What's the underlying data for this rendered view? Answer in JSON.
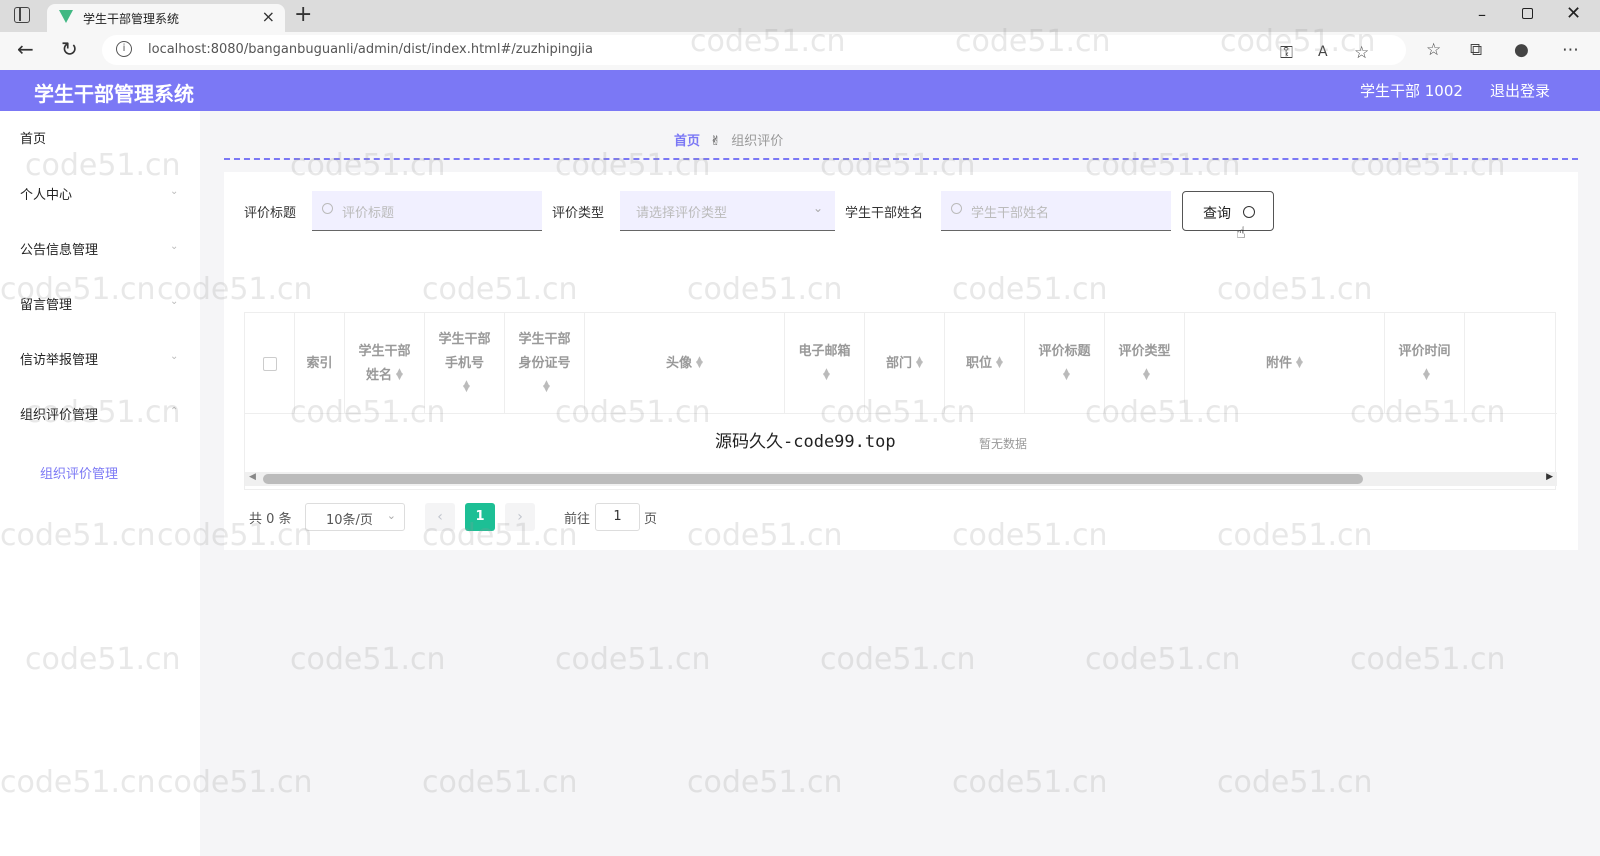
{
  "browser": {
    "tab_title": "学生干部管理系统",
    "tab_close": "×",
    "new_tab": "+",
    "url": "localhost:8080/banganbuguanli/admin/dist/index.html#/zuzhipingjia",
    "window_min": "–",
    "window_close": "✕"
  },
  "header": {
    "app_title": "学生干部管理系统",
    "user": "学生干部 1002",
    "logout": "退出登录"
  },
  "sidebar": {
    "items": [
      {
        "label": "首页"
      },
      {
        "label": "个人中心"
      },
      {
        "label": "公告信息管理"
      },
      {
        "label": "留言管理"
      },
      {
        "label": "信访举报管理"
      },
      {
        "label": "组织评价管理"
      }
    ],
    "submenu_label": "组织评价管理"
  },
  "breadcrumb": {
    "home": "首页",
    "current": "组织评价"
  },
  "filters": {
    "title_label": "评价标题",
    "title_placeholder": "评价标题",
    "type_label": "评价类型",
    "type_placeholder": "请选择评价类型",
    "name_label": "学生干部姓名",
    "name_placeholder": "学生干部姓名",
    "search_button": "查询"
  },
  "table": {
    "columns": {
      "index": "索引",
      "name_1": "学生干部",
      "name_2": "姓名",
      "phone_1": "学生干部",
      "phone_2": "手机号",
      "idcard_1": "学生干部",
      "idcard_2": "身份证号",
      "avatar": "头像",
      "email": "电子邮箱",
      "department": "部门",
      "position": "职位",
      "eval_title": "评价标题",
      "eval_type": "评价类型",
      "attachment": "附件",
      "eval_time": "评价时间"
    },
    "empty_text": "暂无数据",
    "center_watermark": "源码久久-code99.top"
  },
  "pagination": {
    "total": "共 0 条",
    "page_size": "10条/页",
    "current_page": "1",
    "goto_label": "前往",
    "goto_value": "1",
    "page_unit": "页"
  },
  "watermark_text": "code51.cn"
}
